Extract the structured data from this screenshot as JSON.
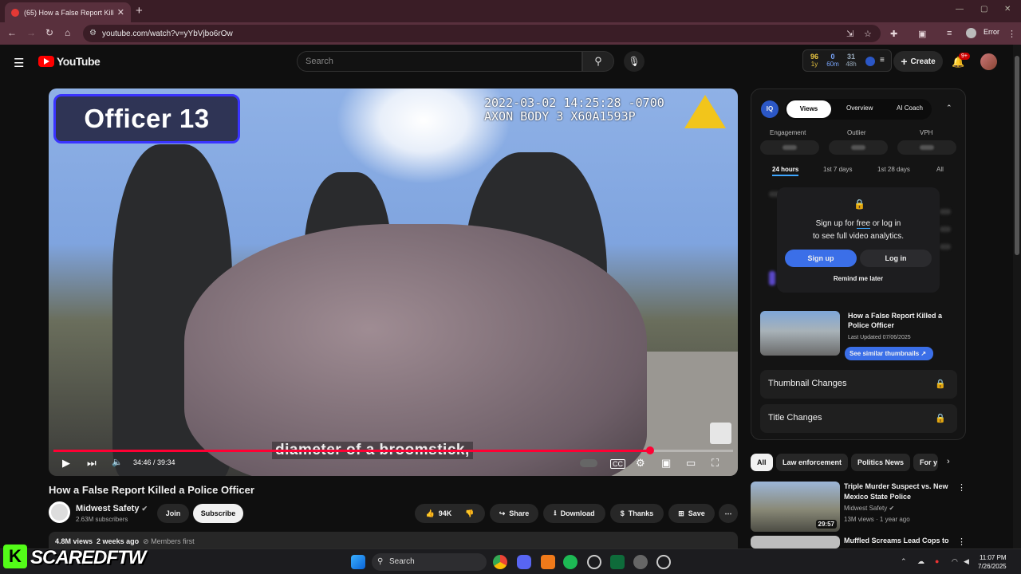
{
  "browser": {
    "tab_title": "(65) How a False Report Killed a",
    "url": "youtube.com/watch?v=yYbVjbo6rOw",
    "error_label": "Error"
  },
  "yt": {
    "logo_text": "YouTube",
    "search_placeholder": "Search",
    "create_label": "Create",
    "notif_count": "9+",
    "stats": [
      {
        "value": "96",
        "sub": "1y"
      },
      {
        "value": "0",
        "sub": "60m"
      },
      {
        "value": "31",
        "sub": "48h"
      }
    ]
  },
  "video": {
    "overlay_badge": "Officer 13",
    "timestamp_line1": "2022-03-02 14:25:28 -0700",
    "timestamp_line2": "AXON BODY 3 X60A1593P",
    "caption": "diameter of a broomstick,",
    "time": "34:46 / 39:34",
    "progress": 0.878
  },
  "meta": {
    "title": "How a False Report Killed a Police Officer",
    "channel": "Midwest Safety",
    "subs": "2.63M subscribers",
    "join": "Join",
    "subscribe": "Subscribe",
    "likes": "94K",
    "share": "Share",
    "download": "Download",
    "thanks": "Thanks",
    "save": "Save",
    "views": "4.8M views",
    "age": "2 weeks ago",
    "members": "Members first"
  },
  "panel": {
    "iq": "IQ",
    "tabs": [
      "Views",
      "Overview",
      "AI Coach"
    ],
    "metrics": [
      "Engagement",
      "Outlier",
      "VPH"
    ],
    "periods": [
      "24 hours",
      "1st 7 days",
      "1st 28 days",
      "All"
    ],
    "gate_line1_pre": "Sign up for ",
    "gate_free": "free",
    "gate_line1_post": " or log in",
    "gate_line2": "to see full video analytics.",
    "signup": "Sign up",
    "login": "Log in",
    "remind": "Remind me later",
    "thumb_title": "How a False Report Killed a Police Officer",
    "thumb_updated": "Last Updated 07/06/2025",
    "similar": "See similar thumbnails",
    "thumb_changes": "Thumbnail Changes",
    "title_changes": "Title Changes"
  },
  "chips": [
    "All",
    "Law enforcement",
    "Politics News",
    "For y"
  ],
  "recs": [
    {
      "title": "Triple Murder Suspect vs. New Mexico State Police",
      "channel": "Midwest Safety",
      "meta": "13M views · 1 year ago",
      "duration": "29:57"
    },
    {
      "title": "Muffled Screams Lead Cops to",
      "channel": "",
      "meta": "",
      "duration": ""
    }
  ],
  "overlay": {
    "kick": "K",
    "brand": "SCAREDFTW"
  },
  "taskbar": {
    "search": "Search",
    "time": "11:07 PM",
    "date": "7/26/2025"
  },
  "colors": {
    "accent": "#ff0033",
    "iq_blue": "#3b6fe8",
    "chrome_tab": "#59303d"
  }
}
